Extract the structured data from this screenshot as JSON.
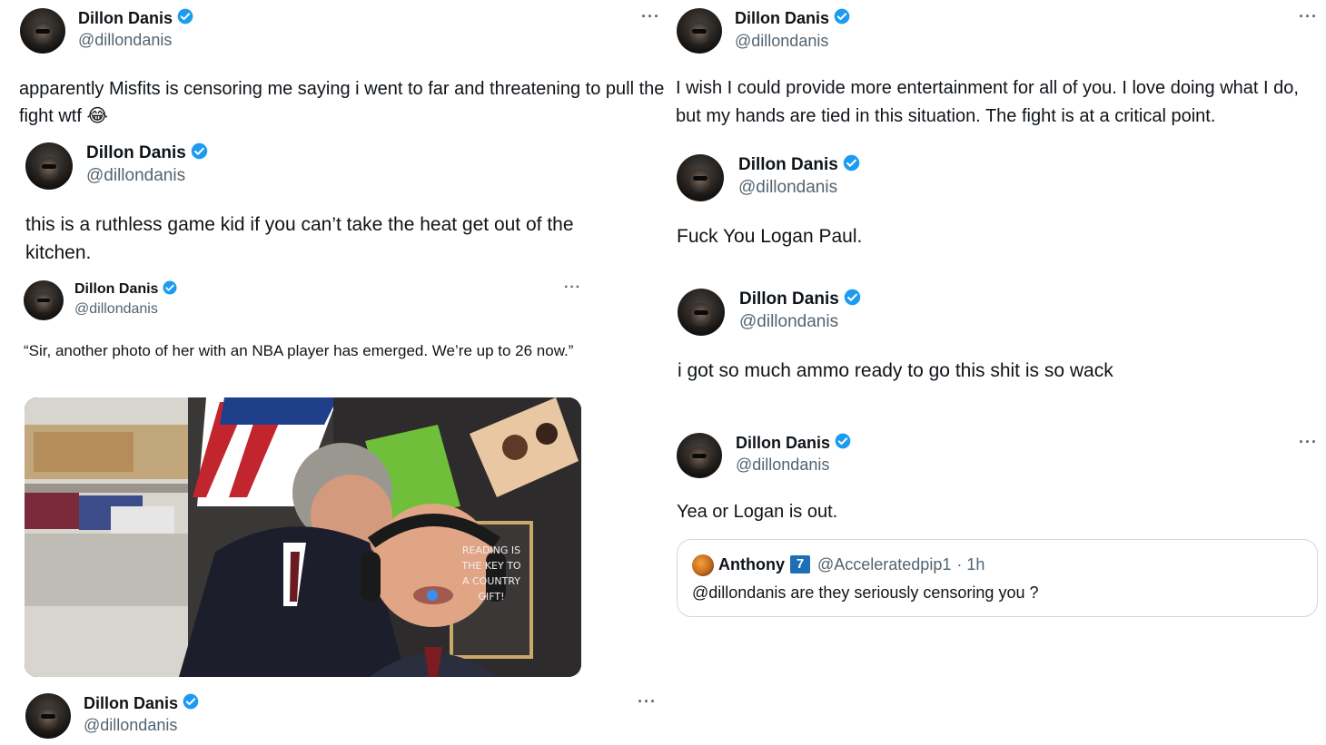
{
  "user": {
    "name": "Dillon Danis",
    "handle": "@dillondanis"
  },
  "more_label": "···",
  "left": {
    "t1_text": "apparently Misfits is censoring me saying i went to far and threatening to pull the fight wtf",
    "t1_emoji": "😂",
    "t2_text": "this is a ruthless game kid if you can’t take the heat get out of the kitchen.",
    "t3_text": "“Sir, another photo of her with an NBA player has emerged. We’re up to 26 now.”"
  },
  "meme": {
    "chalkboard_text": "READING IS THE KEY TO A COUNTRY GIFT!"
  },
  "right": {
    "t1_text": "I wish I could provide more entertainment for all of you. I love doing what I do, but my hands are tied in this situation. The fight is at a critical point.",
    "t2_text": "Fuck You Logan Paul.",
    "t3_text": "i got so much ammo ready to go this shit is so wack",
    "t4_text": "Yea or Logan is out."
  },
  "quote": {
    "name": "Anthony",
    "badge": "7",
    "handle": "@Acceleratedpip1",
    "time": "· 1h",
    "text": "@dillondanis are they seriously censoring you ?"
  },
  "colors": {
    "verified": "#1d9bf0",
    "secondary_text": "#536471",
    "border": "#cfd9de"
  }
}
